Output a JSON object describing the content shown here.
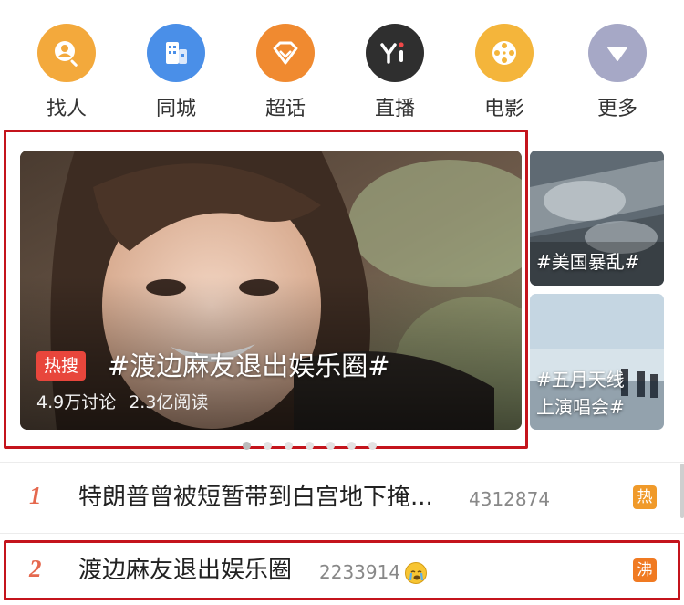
{
  "quick_nav": [
    {
      "label": "找人",
      "icon": "find-people-icon",
      "color": "#f3a93c"
    },
    {
      "label": "同城",
      "icon": "city-building-icon",
      "color": "#4a8fe8"
    },
    {
      "label": "超话",
      "icon": "diamond-icon",
      "color": "#f08a30"
    },
    {
      "label": "直播",
      "icon": "live-yi-icon",
      "color": "#2f2f2f"
    },
    {
      "label": "电影",
      "icon": "film-reel-icon",
      "color": "#f4b53b"
    },
    {
      "label": "更多",
      "icon": "more-triangle-icon",
      "color": "#a6a8c6"
    }
  ],
  "hero": {
    "badge": "热搜",
    "title": "#渡边麻友退出娱乐圈#",
    "discussions": "4.9万讨论",
    "reads": "2.3亿阅读"
  },
  "side_cards": [
    {
      "title": "#美国暴乱#"
    },
    {
      "title_line1": "#五月天线",
      "title_line2": "上演唱会#"
    }
  ],
  "hot_list": [
    {
      "rank": "1",
      "topic": "特朗普曾被短暂带到白宫地下掩...",
      "heat": "4312874",
      "tag": "热",
      "tag_color": "#f09a2a"
    },
    {
      "rank": "2",
      "topic": "渡边麻友退出娱乐圈",
      "heat": "2233914",
      "tag": "沸",
      "tag_color": "#f07a22",
      "emoji": "crying-face-icon"
    }
  ],
  "colors": {
    "highlight_frame": "#c4141c",
    "rank": "#e5684e",
    "hero_badge": "#e8463c"
  }
}
